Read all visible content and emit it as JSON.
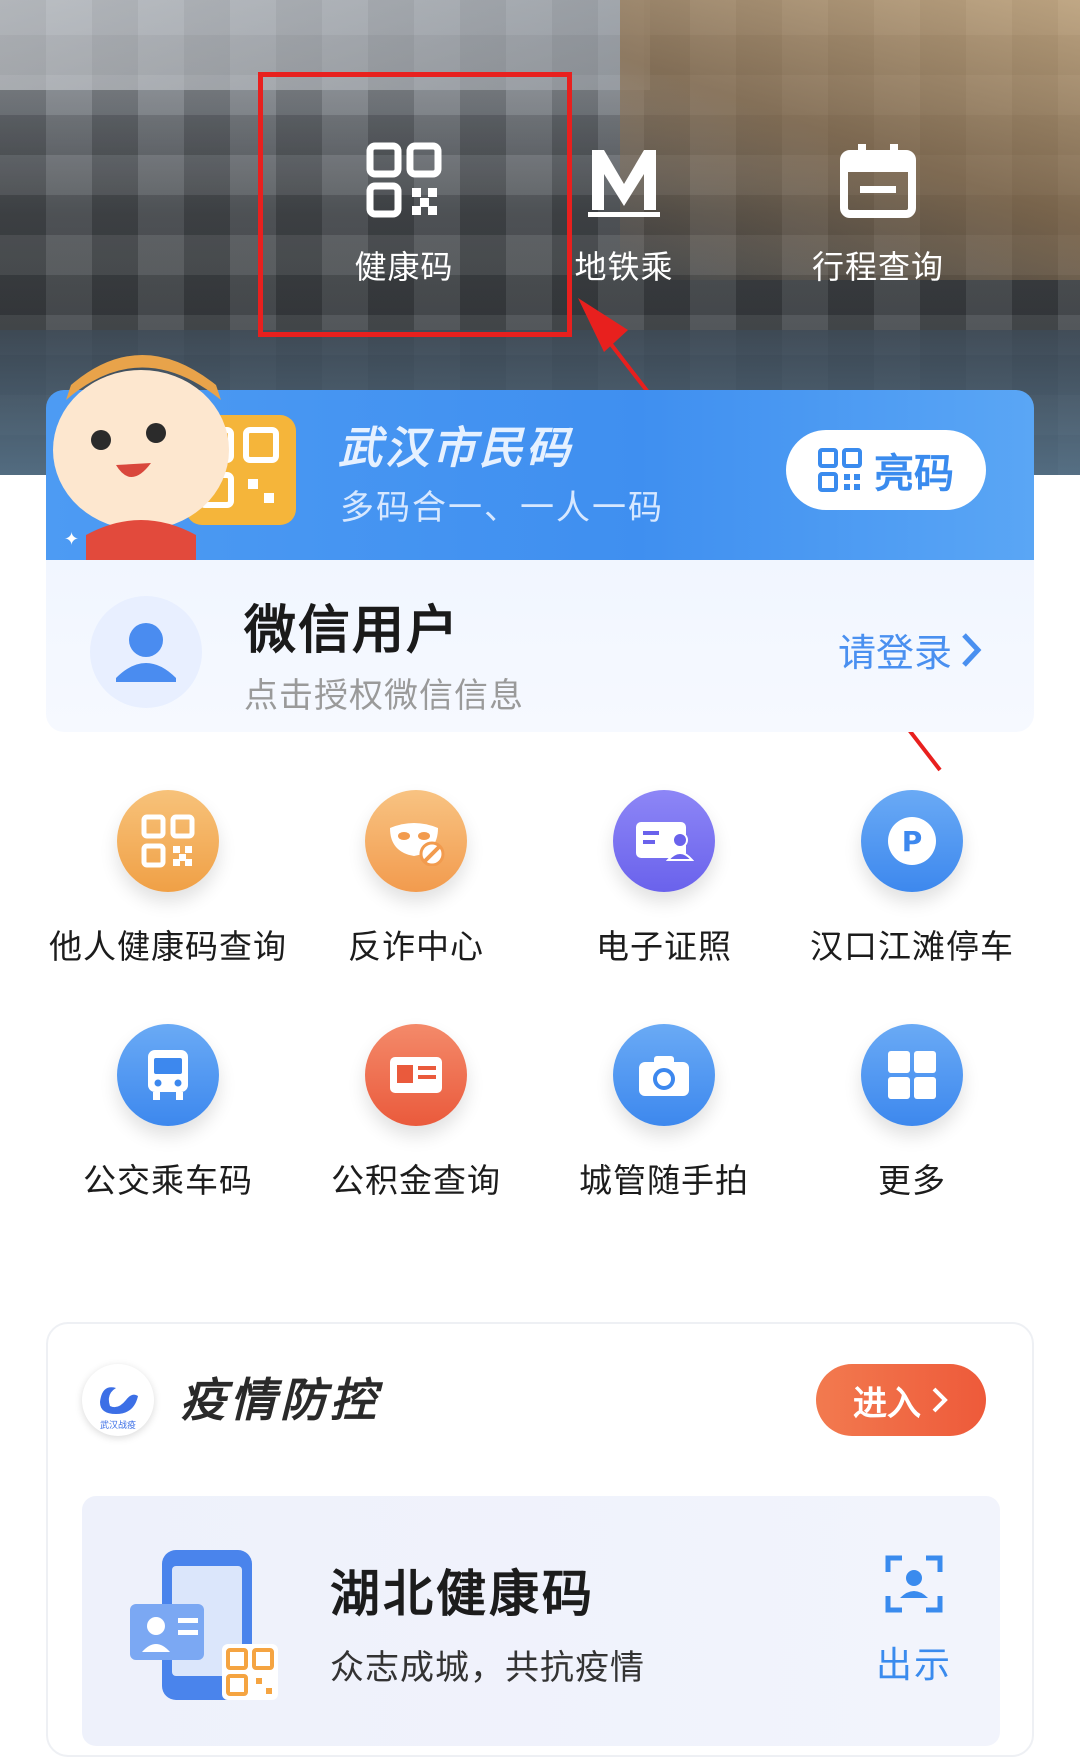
{
  "hero": {
    "quick_links": [
      {
        "label": "健康码",
        "icon": "qr-code-icon"
      },
      {
        "label": "地铁乘",
        "icon": "metro-icon"
      },
      {
        "label": "行程查询",
        "icon": "calendar-icon"
      }
    ]
  },
  "banner": {
    "title": "武汉市民码",
    "subtitle": "多码合一、一人一码",
    "show_code_label": "亮码"
  },
  "user": {
    "name": "微信用户",
    "hint": "点击授权微信信息",
    "login_label": "请登录"
  },
  "services": [
    {
      "label": "他人健康码查询",
      "icon": "qr-code-icon",
      "color": "#f2a851"
    },
    {
      "label": "反诈中心",
      "icon": "mask-icon",
      "color": "#f4a55a"
    },
    {
      "label": "电子证照",
      "icon": "id-card-icon",
      "color": "#7a6ff0"
    },
    {
      "label": "汉口江滩停车",
      "icon": "parking-icon",
      "color": "#4a95f0"
    },
    {
      "label": "公交乘车码",
      "icon": "bus-icon",
      "color": "#4a95f0"
    },
    {
      "label": "公积金查询",
      "icon": "card-icon",
      "color": "#ef6a4d"
    },
    {
      "label": "城管随手拍",
      "icon": "camera-icon",
      "color": "#4a95f0"
    },
    {
      "label": "更多",
      "icon": "grid-icon",
      "color": "#4a95f0"
    }
  ],
  "epidemic": {
    "title": "疫情防控",
    "logo_text": "武汉战疫",
    "enter_label": "进入",
    "card_title": "湖北健康码",
    "card_subtitle": "众志成城，共抗疫情",
    "present_label": "出示"
  },
  "colors": {
    "accent_blue": "#3a8bee",
    "highlight_red": "#e8201e",
    "enter_orange": "#ee5a3a"
  }
}
